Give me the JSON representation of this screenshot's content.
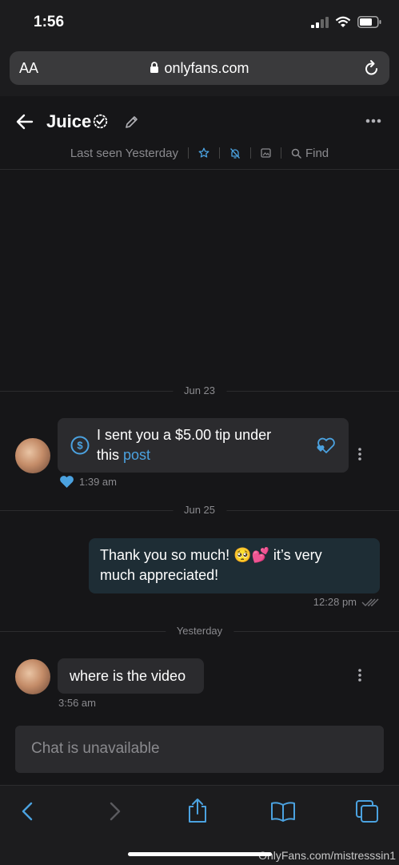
{
  "status_bar": {
    "time": "1:56"
  },
  "browser": {
    "text_size_label": "AA",
    "url": "onlyfans.com"
  },
  "header": {
    "name": "Juice",
    "last_seen": "Last seen Yesterday",
    "find_label": "Find"
  },
  "messages": {
    "date1": "Jun 23",
    "tip_text": "I sent you a $5.00 tip under this",
    "tip_link": "post",
    "tip_time": "1:39 am",
    "date2": "Jun 25",
    "reply_text": "Thank you so much! 🥺💕 it’s very much appreciated!",
    "reply_time": "12:28 pm",
    "date3": "Yesterday",
    "question_text": "where is the video",
    "question_time": "3:56 am"
  },
  "composer": {
    "placeholder": "Chat is unavailable"
  },
  "watermark": "OnlyFans.com/mistresssin1",
  "colors": {
    "accent": "#4ba2e0",
    "background": "#161618",
    "incoming_bubble": "#2b2b2e",
    "outgoing_bubble": "#1e2d35"
  }
}
